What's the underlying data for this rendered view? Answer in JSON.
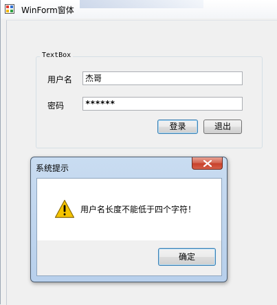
{
  "window": {
    "title": "WinForm窗体"
  },
  "groupbox": {
    "title": "TextBox"
  },
  "form": {
    "username_label": "用户名",
    "username_value": "杰哥",
    "password_label": "密码",
    "password_value": "******",
    "login_label": "登录",
    "exit_label": "退出"
  },
  "dialog": {
    "title": "系统提示",
    "message": "用户名长度不能低于四个字符！",
    "ok_label": "确定"
  },
  "icons": {
    "app": "form-app-icon",
    "close": "close-icon",
    "warning": "warning-icon"
  },
  "colors": {
    "window_bg": "#f0f0f0",
    "dialog_frame": "#b8d0ec",
    "close_button": "#c8412c",
    "warning": "#f5c400"
  }
}
